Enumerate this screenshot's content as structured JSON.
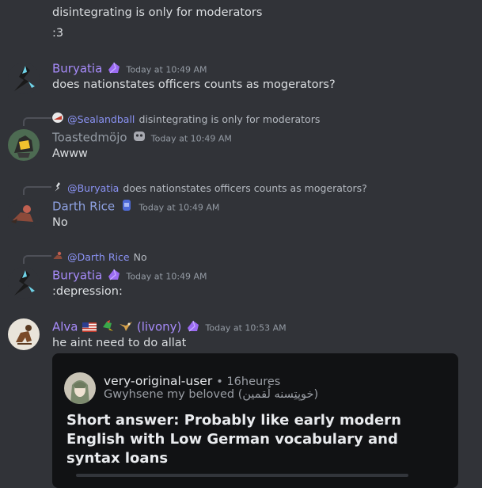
{
  "messages": {
    "top": {
      "line1": "disintegrating is only for moderators",
      "line2": ":3"
    },
    "m1": {
      "author": "Buryatia",
      "author_color": "#a78bfa",
      "timestamp": "Today at 10:49 AM",
      "text": "does nationstates officers counts as mogerators?"
    },
    "m2": {
      "reply_mention": "@Sealandball",
      "reply_text": "disintegrating is only for moderators",
      "author": "Toastedmöjo",
      "author_color": "#949ba4",
      "timestamp": "Today at 10:49 AM",
      "text": "Awww"
    },
    "m3": {
      "reply_mention": "@Buryatia",
      "reply_text": "does nationstates officers counts as mogerators?",
      "author": "Darth Rice",
      "author_color": "#8ea1e1",
      "timestamp": "Today at 10:49 AM",
      "text": "No"
    },
    "m4": {
      "reply_mention": "@Darth Rice",
      "reply_text": "No",
      "author": "Buryatia",
      "author_color": "#a78bfa",
      "timestamp": "Today at 10:49 AM",
      "text": ":depression:"
    },
    "m5": {
      "author": "Alva",
      "author_suffix": "(livony)",
      "author_color": "#a78bfa",
      "timestamp": "Today at 10:53 AM",
      "text": "he aint need to do allat",
      "embed": {
        "poster": "very-original-user",
        "age": "• 16heures",
        "subtitle": "Gwyhsene my beloved (خوپتِسنه لُقمین)",
        "body": "Short answer: Probably like early modern English with Low German vocabulary and syntax loans"
      }
    }
  },
  "colors": {
    "background": "#313338",
    "mention": "#8b93f5",
    "timestamp": "#949ba4"
  },
  "icons": {
    "badge": "purple-crystal-badge-icon",
    "flag": "us-flag-icon"
  }
}
